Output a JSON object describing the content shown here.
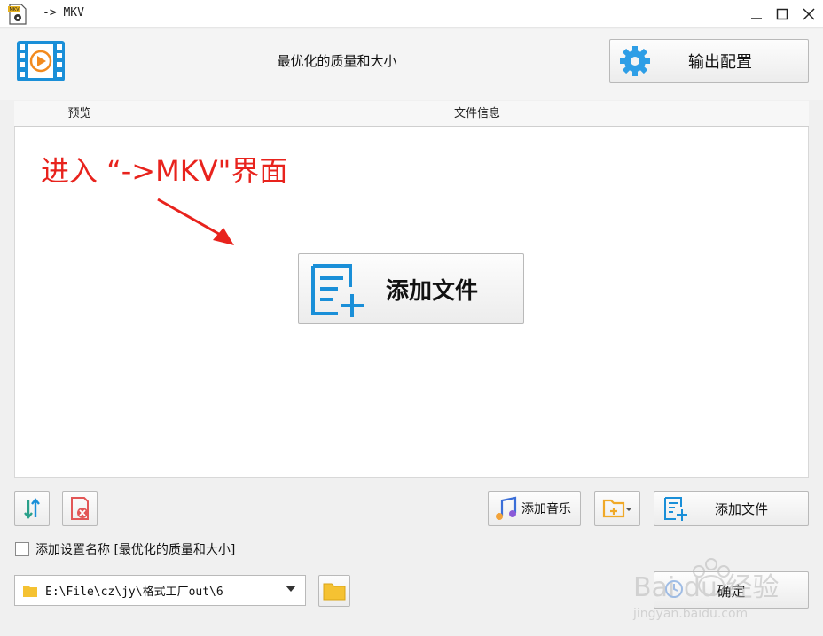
{
  "window": {
    "title": "-> MKV",
    "app_icon_label": "MKV"
  },
  "header": {
    "profile_title": "最优化的质量和大小",
    "output_config_label": "输出配置"
  },
  "table": {
    "columns": [
      "预览",
      "文件信息"
    ]
  },
  "annotation": {
    "text": "进入 “->MKV\"界面",
    "color": "#e8231d"
  },
  "actions": {
    "add_file_big_label": "添加文件",
    "add_music_label": "添加音乐",
    "add_file_small_label": "添加文件",
    "ok_label": "确定"
  },
  "options": {
    "add_setting_name_label": "添加设置名称 [最优化的质量和大小]",
    "add_setting_name_checked": false
  },
  "output": {
    "path": "E:\\File\\cz\\jy\\格式工厂out\\6"
  },
  "colors": {
    "accent_blue": "#1a8fd8",
    "red": "#e8231d",
    "folder_yellow": "#f5c232"
  },
  "watermark": {
    "brand": "Bai du 经验",
    "url": "jingyan.baidu.com"
  }
}
